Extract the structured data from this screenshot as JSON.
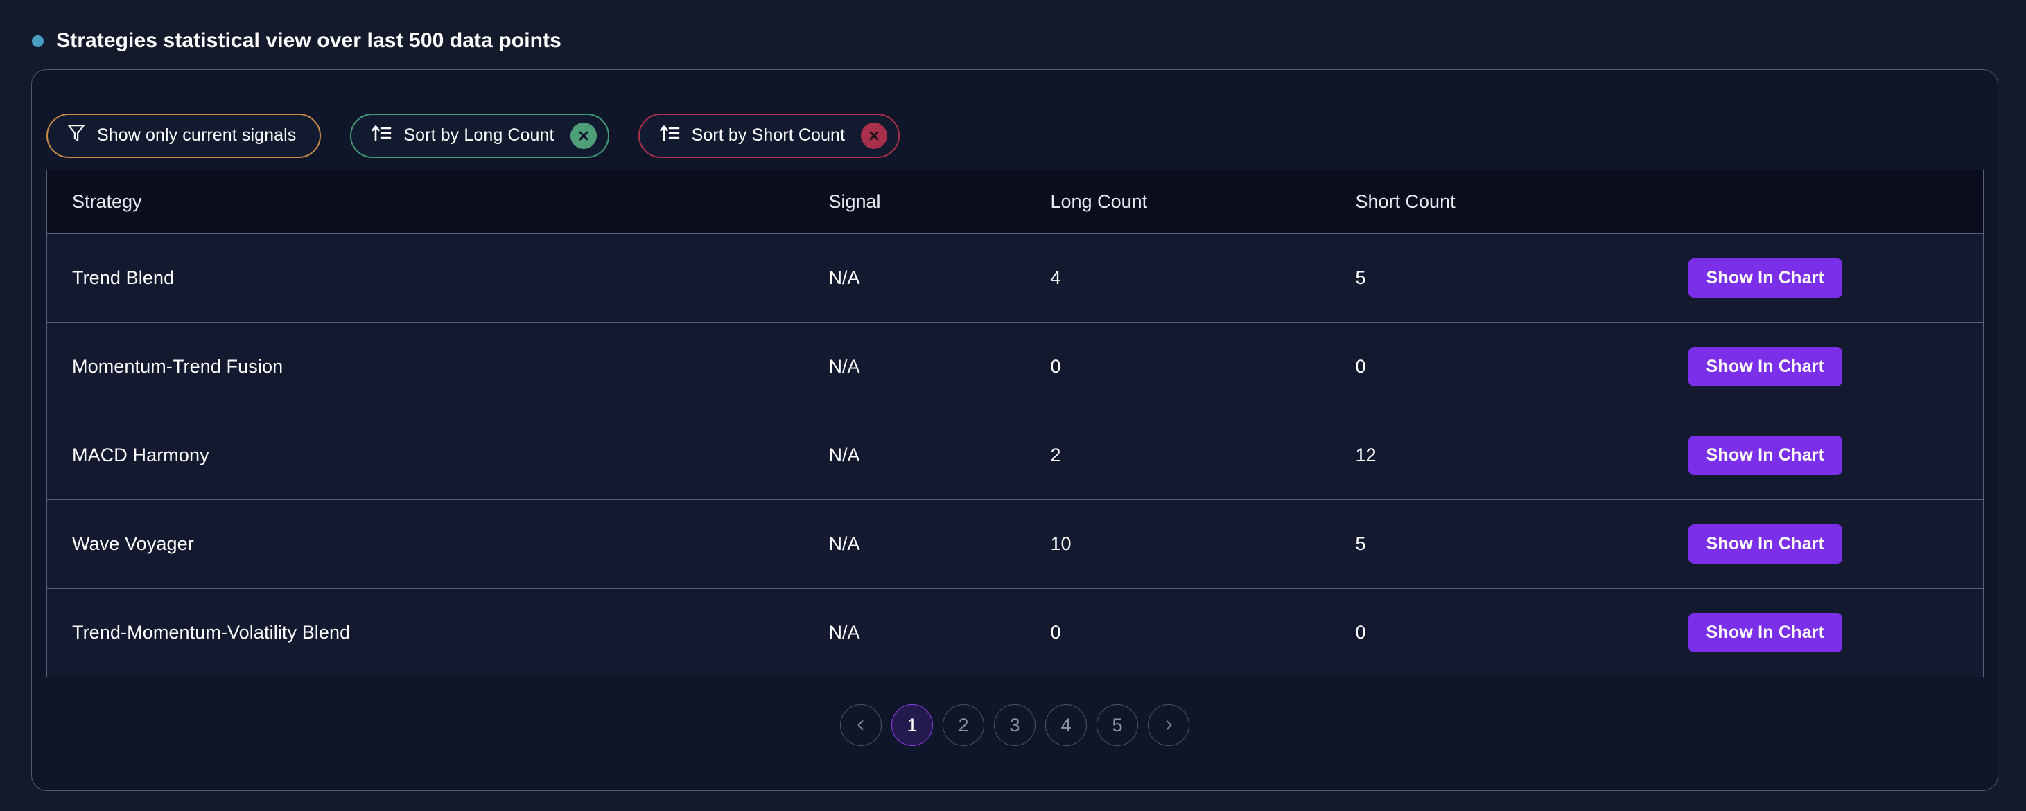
{
  "header": {
    "title": "Strategies statistical view over last 500 data points",
    "bullet_color": "#4a9ec2"
  },
  "controls": {
    "filter": {
      "label": "Show only current signals",
      "icon": "funnel-icon",
      "border_color": "#c68a4b"
    },
    "sort_long": {
      "label": "Sort by Long Count",
      "icon": "sort-ascending-icon",
      "clear_icon": "close-circle-icon",
      "border_color": "#3f9c76",
      "badge_color": "#4f9e7a"
    },
    "sort_short": {
      "label": "Sort by Short Count",
      "icon": "sort-ascending-icon",
      "clear_icon": "close-circle-icon",
      "border_color": "#a8304a",
      "badge_color": "#a8304a"
    }
  },
  "table": {
    "columns": [
      "Strategy",
      "Signal",
      "Long Count",
      "Short Count"
    ],
    "action_label": "Show In Chart",
    "rows": [
      {
        "strategy": "Trend Blend",
        "signal": "N/A",
        "long_count": "4",
        "short_count": "5"
      },
      {
        "strategy": "Momentum-Trend Fusion",
        "signal": "N/A",
        "long_count": "0",
        "short_count": "0"
      },
      {
        "strategy": "MACD Harmony",
        "signal": "N/A",
        "long_count": "2",
        "short_count": "12"
      },
      {
        "strategy": "Wave Voyager",
        "signal": "N/A",
        "long_count": "10",
        "short_count": "5"
      },
      {
        "strategy": "Trend-Momentum-Volatility Blend",
        "signal": "N/A",
        "long_count": "0",
        "short_count": "0"
      }
    ]
  },
  "pagination": {
    "prev_icon": "chevron-left-icon",
    "next_icon": "chevron-right-icon",
    "pages": [
      "1",
      "2",
      "3",
      "4",
      "5"
    ],
    "current_page": "1",
    "active_color": "#8b3ce8"
  },
  "theme": {
    "page_background": "#131a2b",
    "card_background": "#101629",
    "header_row_background": "#090d1c",
    "row_background": "#131a30",
    "accent_purple": "#7c2fe8"
  }
}
